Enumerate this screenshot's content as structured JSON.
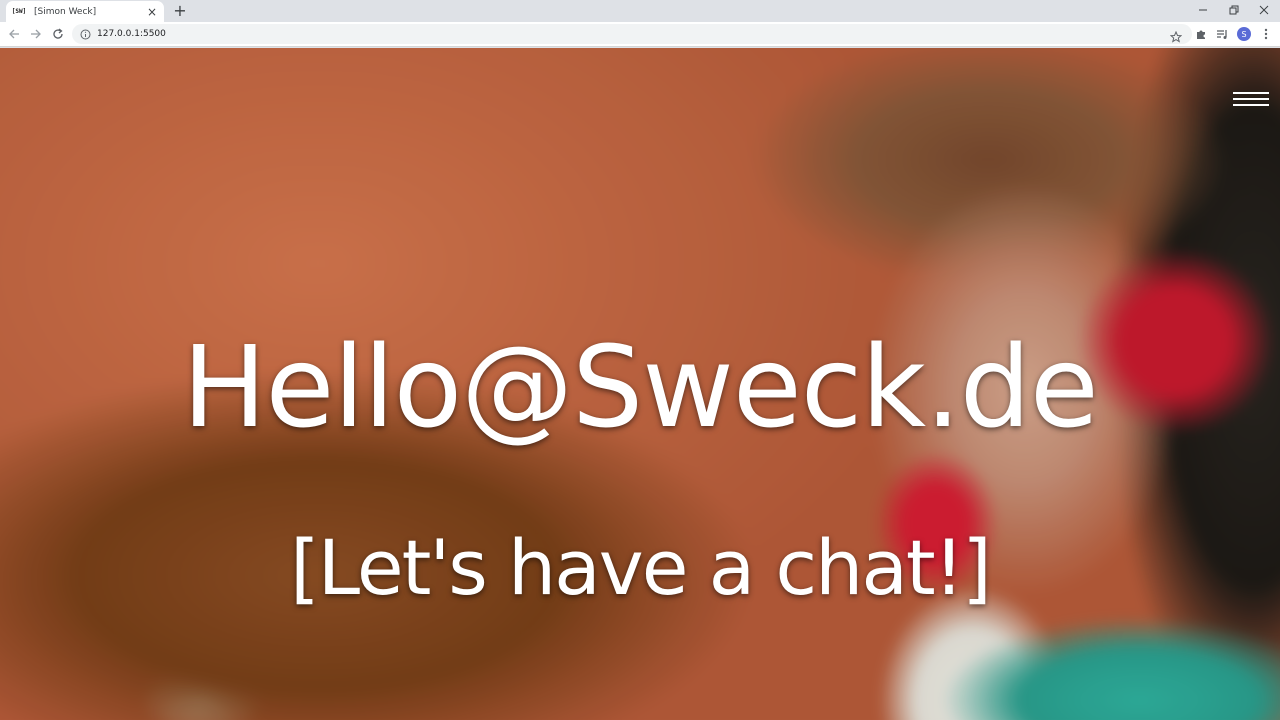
{
  "browser": {
    "tab": {
      "favicon_text": "[SW]",
      "title": "[Simon Weck]"
    },
    "new_tab_symbol": "+",
    "url": "127.0.0.1:5500",
    "profile_initial": "S"
  },
  "page": {
    "headline": "Hello@Sweck.de",
    "subline": "[Let's have a chat!]"
  },
  "icons": {
    "back": "back-arrow-icon",
    "forward": "forward-arrow-icon",
    "reload": "reload-icon",
    "info": "info-icon",
    "star": "star-icon",
    "extensions": "puzzle-icon",
    "media": "media-queue-icon",
    "menu": "kebab-menu-icon",
    "hamburger": "hamburger-menu-icon"
  },
  "colors": {
    "tabstrip": "#dee1e6",
    "toolbar": "#ffffff",
    "omnibox": "#f1f3f4",
    "avatar": "#5a6bd6",
    "text_on_hero": "#ffffff"
  }
}
